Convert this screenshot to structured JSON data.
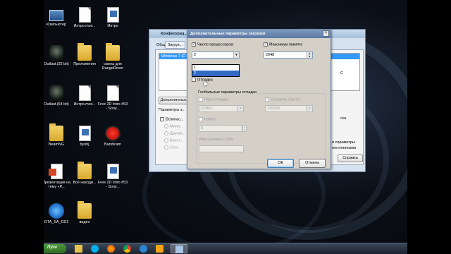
{
  "desktop": {
    "icons": [
      {
        "label": "Компьютер",
        "icon": "computer-icon",
        "kind": "comp"
      },
      {
        "label": "Интро.mov...",
        "icon": "file-icon",
        "kind": "file"
      },
      {
        "label": "Интро",
        "icon": "video-icon",
        "kind": "doc"
      },
      {
        "label": "Outlast.(32 bit)",
        "icon": "game-icon",
        "kind": "game"
      },
      {
        "label": "Приложения",
        "icon": "folder-icon",
        "kind": "folder"
      },
      {
        "label": "скины для RangeRover",
        "icon": "folder-icon",
        "kind": "folder"
      },
      {
        "label": "Outlast.(64 bit)",
        "icon": "game-icon",
        "kind": "game"
      },
      {
        "label": "Интро.mov...",
        "icon": "file-icon",
        "kind": "file"
      },
      {
        "label": "Free 2D Intro #53 - Sony...",
        "icon": "file-icon",
        "kind": "file"
      },
      {
        "label": "BeamNG",
        "icon": "folder-icon",
        "kind": "folder"
      },
      {
        "label": "bynhj",
        "icon": "video-icon",
        "kind": "doc"
      },
      {
        "label": "Bandicam",
        "icon": "record-icon",
        "kind": "rec"
      },
      {
        "label": "Презентация на тему «Р...",
        "icon": "presentation-icon",
        "kind": "ppt"
      },
      {
        "label": "Всё находи...",
        "icon": "folder-icon",
        "kind": "folder"
      },
      {
        "label": "Free 2D Intro #53 - Sony...",
        "icon": "video-icon",
        "kind": "doc"
      },
      {
        "label": "GTA_SA_CD2",
        "icon": "gta-icon",
        "kind": "gta"
      },
      {
        "label": "видео",
        "icon": "folder-icon",
        "kind": "folder"
      }
    ]
  },
  "back_window": {
    "title": "Конфигурац...",
    "tabs": [
      "Общие",
      "Загруз..."
    ],
    "os_item": "Windows 7 (C:",
    "advanced_button": "Дополнительн...",
    "params_label": "Параметры з...",
    "safe_mode": "Безопас...",
    "sub_options": [
      "Мини...",
      "Другая...",
      "Восст...",
      "Сеть"
    ],
    "right_fragments": [
      "C",
      "сек.",
      "и параметры",
      "постоянными"
    ],
    "help_button": "Справка"
  },
  "dialog": {
    "title": "Дополнительные параметры загрузки",
    "close": "×",
    "num_processors": {
      "label": "Число процессоров:",
      "checked": true,
      "value": "2"
    },
    "max_memory": {
      "label": "Максимум памяти:",
      "checked": true,
      "value": "2048"
    },
    "dropdown_options": [
      "1",
      "2"
    ],
    "dropdown_selected": "2",
    "debug": {
      "label": "Отладка",
      "checked": false
    },
    "global_debug": {
      "title": "Глобальные параметры отладки",
      "debug_port": {
        "label": "Порт отладки:",
        "value": "COM1:"
      },
      "baud_rate": {
        "label": "Скорость (бит/с):",
        "value": "115200"
      },
      "channel": {
        "label": "Канал:",
        "value": "0"
      },
      "usb_target": {
        "label": "Имя целевого USB:",
        "value": ""
      }
    },
    "ok_button": "ОК",
    "cancel_button": "Отмена"
  },
  "taskbar": {
    "start_label": "Пуск",
    "apps": [
      "explorer-icon",
      "skype-icon",
      "firefox-icon",
      "chrome-icon",
      "media-player-icon",
      "video-icon",
      "msconfig-icon"
    ]
  },
  "colors": {
    "selection": "#316ac5",
    "dialog_bg": "#d4d0c8",
    "title_blue": "#5b7aa5"
  }
}
